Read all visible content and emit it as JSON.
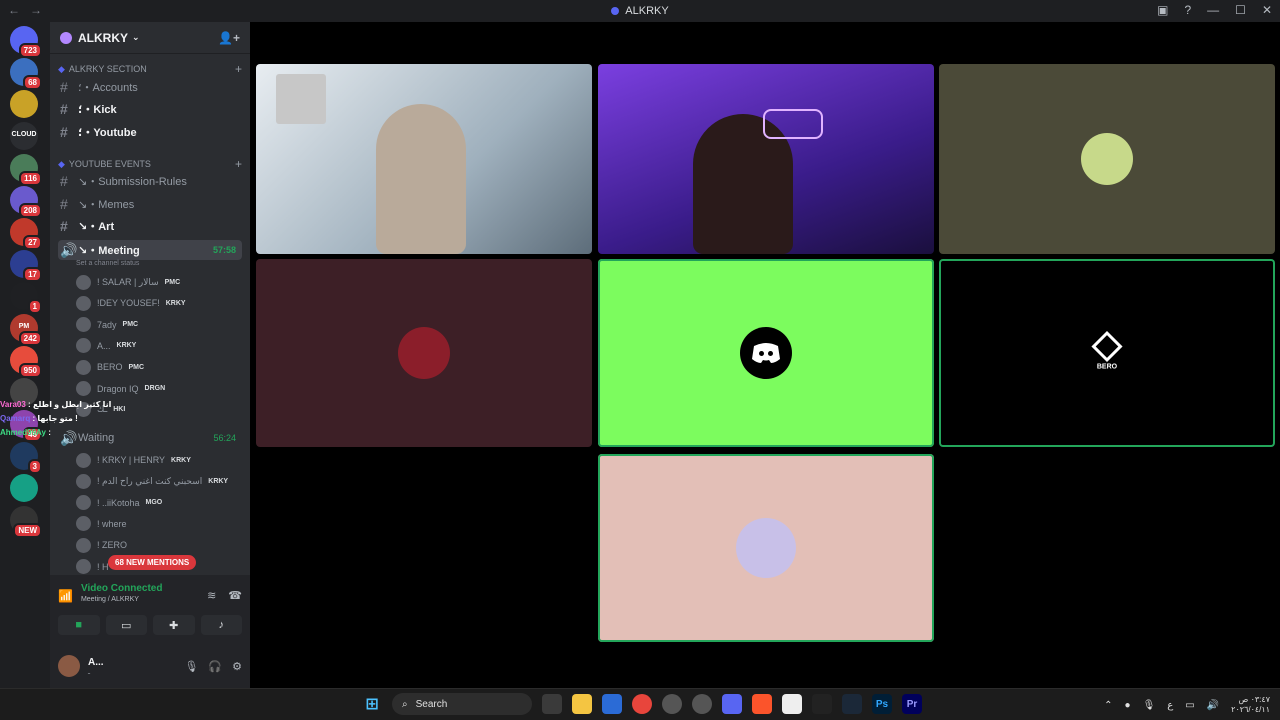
{
  "window": {
    "title": "ALKRKY",
    "back_label": "←",
    "fwd_label": "→",
    "right_icons": [
      "▣",
      "?",
      "—",
      "☐",
      "✕"
    ]
  },
  "guilds": [
    {
      "badge": "723",
      "color": "#5865f2"
    },
    {
      "badge": "68",
      "color": "#3b6fbf"
    },
    {
      "badge": "",
      "color": "#c9a227"
    },
    {
      "badge": "",
      "color": "#2b2d31",
      "label": "CLOUD"
    },
    {
      "badge": "116",
      "color": "#4a7c59"
    },
    {
      "badge": "208",
      "color": "#6a5acd"
    },
    {
      "badge": "27",
      "color": "#c0392b"
    },
    {
      "badge": "17",
      "color": "#2c3e91"
    },
    {
      "badge": "1",
      "color": "#1f2023"
    },
    {
      "badge": "242",
      "color": "#b03a2e",
      "label": "PM"
    },
    {
      "badge": "950",
      "color": "#e74c3c"
    },
    {
      "badge": "",
      "color": "#444"
    },
    {
      "badge": "46",
      "color": "#8e44ad"
    },
    {
      "badge": "3",
      "color": "#1f3a5f"
    },
    {
      "badge": "",
      "color": "#16a085"
    },
    {
      "badge": "NEW",
      "color": "#333"
    }
  ],
  "server": {
    "name": "ALKRKY",
    "categories": [
      {
        "name": "ALKRKY SECTION"
      },
      {
        "name": "YOUTUBE EVENTS"
      }
    ],
    "channels_a": [
      {
        "name": "؛・Accounts",
        "bold": false
      },
      {
        "name": "؛・Kick",
        "bold": true
      },
      {
        "name": "؛・Youtube",
        "bold": true
      }
    ],
    "channels_b": [
      {
        "name": "↘・Submission-Rules",
        "bold": false
      },
      {
        "name": "↘・Memes",
        "bold": false
      },
      {
        "name": "↘・Art",
        "bold": true
      }
    ],
    "voice_channel": {
      "name": "↘・Meeting",
      "timer": "57:58",
      "status": "Set a channel status"
    },
    "members": [
      {
        "name": "! SALAR | سالار",
        "tag": "PMC"
      },
      {
        "name": "!DEY YOUSEF!",
        "tag": "KRKY"
      },
      {
        "name": "7ady",
        "tag": "PMC"
      },
      {
        "name": "A...",
        "tag": "KRKY"
      },
      {
        "name": "BERO",
        "tag": "PMC"
      },
      {
        "name": "Dragon IQ",
        "tag": "DRGN"
      },
      {
        "name": "ـك",
        "tag": "HKI"
      }
    ],
    "waiting_channel": {
      "name": "Waiting",
      "timer": "56:24"
    },
    "waiting_members": [
      {
        "name": "! KRKY | HENRY",
        "tag": "KRKY"
      },
      {
        "name": "! اسحبني كنت اغني راح الدم",
        "tag": "KRKY"
      },
      {
        "name": "! ..iiKotoha",
        "tag": "MGO"
      },
      {
        "name": "! where",
        "tag": ""
      },
      {
        "name": "! ZERO",
        "tag": ""
      },
      {
        "name": "! H",
        "tag": ""
      }
    ],
    "mentions_pill": "68 NEW MENTIONS"
  },
  "overlay_chat": [
    {
      "user": "Vara03",
      "text": ": انا كثير ابطل و اطلع",
      "color": "#ff6bd5"
    },
    {
      "user": "Qamarq",
      "text": ": متو جابها !",
      "color": "#7b68ee"
    },
    {
      "user": "Ahmed99Ay",
      "text": ":",
      "color": "#3ddc84"
    }
  ],
  "voice_panel": {
    "title": "Video Connected",
    "subtitle": "Meeting / ALKRKY",
    "user_name": "A...",
    "user_status": "ـ"
  },
  "tiles": [
    {
      "name": "SALAR",
      "kind": "video",
      "bg": "#c9d3dc"
    },
    {
      "name": "BERO-video",
      "kind": "video",
      "bg": "#4b2aa8"
    },
    {
      "name": "olive",
      "kind": "avatar",
      "bg": "#4b4a38",
      "avatar": "#c7d98a"
    },
    {
      "name": "DEY YOUSEF",
      "kind": "avatar",
      "bg": "#3d1f26",
      "avatar": "#8b1e2a"
    },
    {
      "name": "discord",
      "kind": "discord",
      "bg": "#7cfc5e",
      "avatar": "#000000"
    },
    {
      "name": "BERO",
      "kind": "bero",
      "bg": "#000000",
      "label": "BERO"
    },
    {
      "name": "anime",
      "kind": "avatar",
      "bg": "#e3bfb7",
      "avatar": "#c8c0e8"
    }
  ],
  "taskbar": {
    "search_label": "Search",
    "apps": [
      "Ps",
      "Pr"
    ],
    "clock_time": "٠٣:٤٧ ص",
    "clock_date": "٢٠٢٦/٠٤/١١",
    "lang": "ع"
  }
}
